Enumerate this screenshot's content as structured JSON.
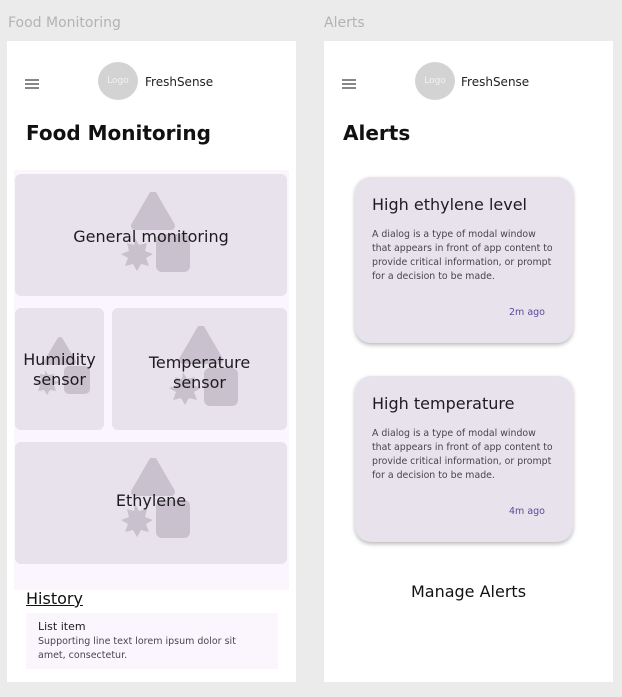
{
  "frames": {
    "left_label": "Food Monitoring",
    "right_label": "Alerts"
  },
  "header": {
    "logo_text": "Logo",
    "brand": "FreshSense"
  },
  "food_monitoring": {
    "title": "Food Monitoring",
    "cards": [
      {
        "label": "General monitoring"
      },
      {
        "label": "Humidity sensor",
        "lines": [
          "Humidity",
          "sensor"
        ]
      },
      {
        "label": "Temperature sensor",
        "lines": [
          "Temperature",
          "sensor"
        ]
      },
      {
        "label": "Ethylene"
      }
    ],
    "history": {
      "title": "History",
      "items": [
        {
          "title": "List item",
          "support": "Supporting line text lorem ipsum dolor sit amet, consectetur."
        }
      ]
    }
  },
  "alerts": {
    "title": "Alerts",
    "items": [
      {
        "title": "High ethylene level",
        "body": "A dialog is a type of modal window that appears in front of app content to provide critical information, or prompt for a decision to be made.",
        "time": "2m ago"
      },
      {
        "title": "High temperature",
        "body": "A dialog is a type of modal window that appears in front of app content to provide critical information, or prompt for a decision to be made.",
        "time": "4m ago"
      }
    ],
    "manage_label": "Manage Alerts"
  },
  "colors": {
    "card_bg": "#e8e2ec",
    "placeholder_shape": "#c9c1cd",
    "accent_text": "#5b4a9a"
  }
}
